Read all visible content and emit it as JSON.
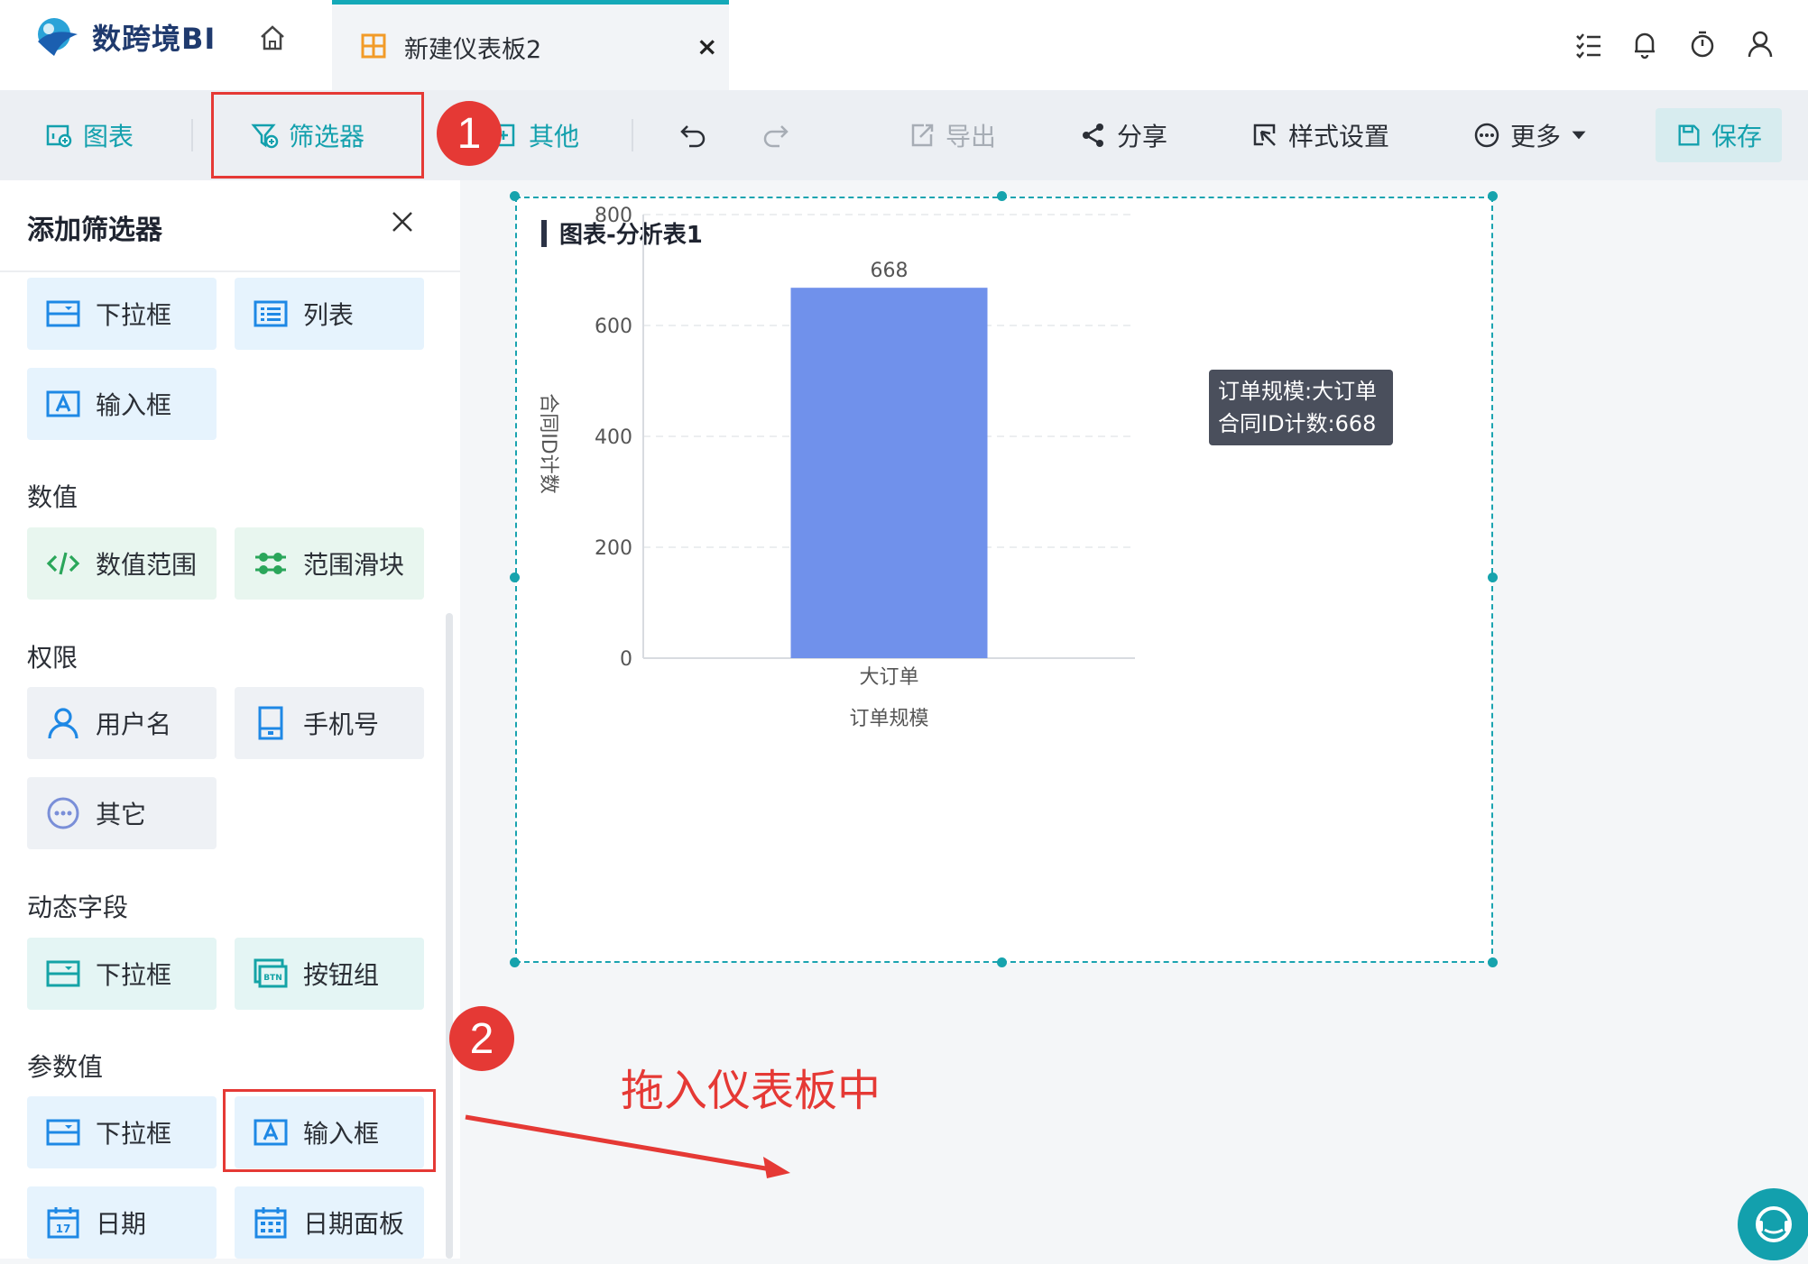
{
  "app": {
    "name": "数跨境BI"
  },
  "tab": {
    "label": "新建仪表板2",
    "close": "×"
  },
  "toolbar": {
    "chart": "图表",
    "filter": "筛选器",
    "other": "其他",
    "export": "导出",
    "share": "分享",
    "style": "样式设置",
    "more": "更多",
    "save": "保存"
  },
  "badges": {
    "one": "1",
    "two": "2"
  },
  "panel": {
    "title": "添加筛选器",
    "top_cards": [
      {
        "label": "下拉框"
      },
      {
        "label": "列表"
      },
      {
        "label": "输入框"
      }
    ],
    "numeric": {
      "title": "数值",
      "cards": [
        {
          "label": "数值范围"
        },
        {
          "label": "范围滑块"
        }
      ]
    },
    "permission": {
      "title": "权限",
      "cards": [
        {
          "label": "用户名"
        },
        {
          "label": "手机号"
        },
        {
          "label": "其它"
        }
      ]
    },
    "dynamic": {
      "title": "动态字段",
      "cards": [
        {
          "label": "下拉框"
        },
        {
          "label": "按钮组"
        }
      ]
    },
    "param": {
      "title": "参数值",
      "cards": [
        {
          "label": "下拉框"
        },
        {
          "label": "输入框"
        },
        {
          "label": "日期"
        },
        {
          "label": "日期面板"
        }
      ]
    }
  },
  "widget": {
    "title": "图表-分析表1"
  },
  "chart_data": {
    "type": "bar",
    "categories": [
      "大订单"
    ],
    "values": [
      668
    ],
    "data_labels": [
      "668"
    ],
    "xlabel": "订单规模",
    "ylabel": "合同ID计数",
    "ylim": [
      0,
      800
    ],
    "yticks": [
      0,
      200,
      400,
      600,
      800
    ],
    "grid": true,
    "bar_color": "#7091eb"
  },
  "tooltip": {
    "line1": "订单规模:大订单",
    "line2": "合同ID计数:668"
  },
  "annotation": {
    "text": "拖入仪表板中"
  },
  "colors": {
    "accent": "#13a0ad",
    "highlight": "#e53935"
  }
}
